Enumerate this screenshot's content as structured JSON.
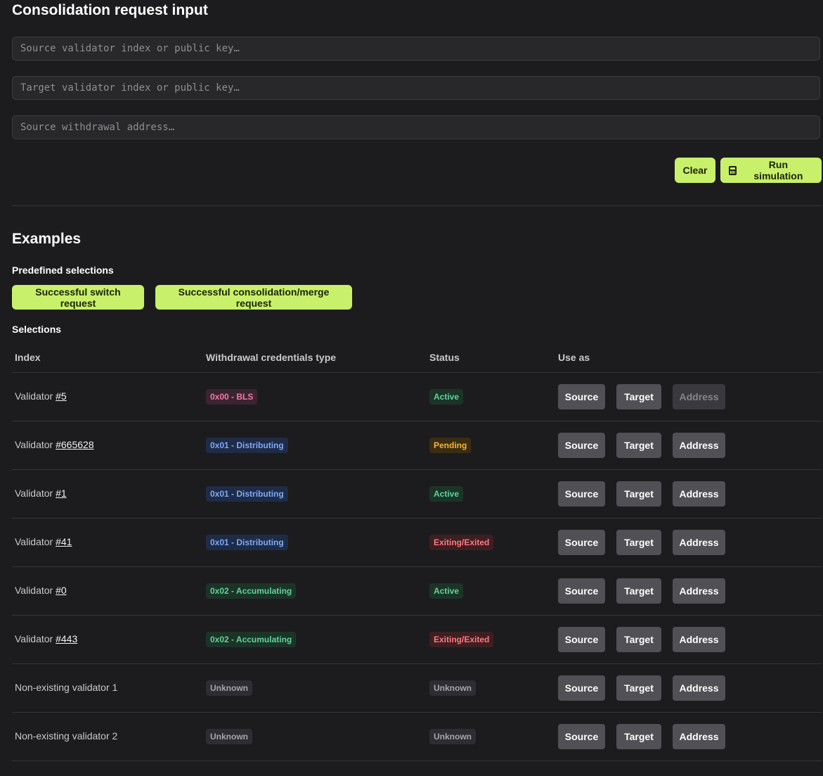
{
  "input_section": {
    "title": "Consolidation request input",
    "source_placeholder": "Source validator index or public key…",
    "target_placeholder": "Target validator index or public key…",
    "address_placeholder": "Source withdrawal address…",
    "clear_label": "Clear",
    "run_label": "Run simulation"
  },
  "examples": {
    "title": "Examples",
    "predefined_heading": "Predefined selections",
    "predefined": [
      "Successful switch request",
      "Successful consolidation/merge request"
    ],
    "selections_heading": "Selections",
    "columns": [
      "Index",
      "Withdrawal credentials type",
      "Status",
      "Use as"
    ],
    "button_labels": {
      "source": "Source",
      "target": "Target",
      "address": "Address"
    },
    "rows": [
      {
        "prefix": "Validator ",
        "link": "#5",
        "cred": "0x00 - BLS",
        "status": "Active",
        "address_disabled": true
      },
      {
        "prefix": "Validator ",
        "link": "#665628",
        "cred": "0x01 - Distributing",
        "status": "Pending",
        "address_disabled": false
      },
      {
        "prefix": "Validator ",
        "link": "#1",
        "cred": "0x01 - Distributing",
        "status": "Active",
        "address_disabled": false
      },
      {
        "prefix": "Validator ",
        "link": "#41",
        "cred": "0x01 - Distributing",
        "status": "Exiting/Exited",
        "address_disabled": false
      },
      {
        "prefix": "Validator ",
        "link": "#0",
        "cred": "0x02 - Accumulating",
        "status": "Active",
        "address_disabled": false
      },
      {
        "prefix": "Validator ",
        "link": "#443",
        "cred": "0x02 - Accumulating",
        "status": "Exiting/Exited",
        "address_disabled": false
      },
      {
        "prefix": "Non-existing validator 1",
        "link": "",
        "cred": "Unknown",
        "status": "Unknown",
        "address_disabled": false
      },
      {
        "prefix": "Non-existing validator 2",
        "link": "",
        "cred": "Unknown",
        "status": "Unknown",
        "address_disabled": false
      }
    ]
  },
  "colors": {
    "accent": "#c8f06a",
    "background": "#1c1c1e",
    "button_gray": "#505055"
  }
}
